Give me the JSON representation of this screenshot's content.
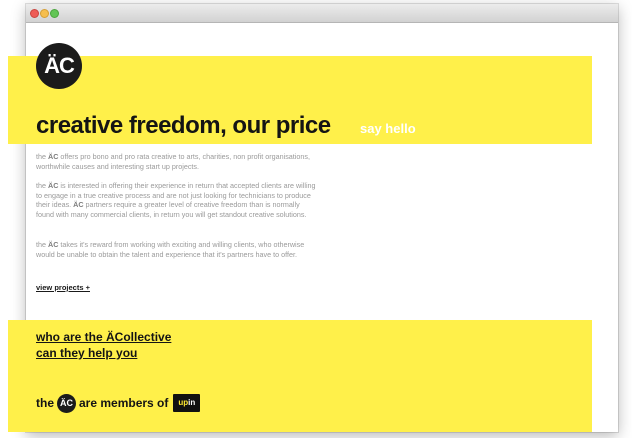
{
  "window": {
    "controls": [
      "close",
      "minimize",
      "zoom"
    ]
  },
  "logo": {
    "text": "ÄC"
  },
  "hero": {
    "headline": "creative freedom, our price",
    "say_hello": "say hello"
  },
  "intro": {
    "p1_prefix": "the ",
    "p1_brand": "ÄC",
    "p1_rest": " offers pro bono and pro rata creative to arts, charities, non profit organisations, worthwhile causes and interesting start up projects.",
    "p2_prefix": "the ",
    "p2_brand": "ÄC",
    "p2_mid": " is interested in offering their experience in return that accepted clients are willing to engage in a true creative process and are not just looking for technicians to produce their ideas. ",
    "p2_brand2": "ÄC",
    "p2_rest": " partners require a greater level of creative freedom than is normally found with many commercial clients, in return you will get standout creative solutions.",
    "p3_prefix": "the ",
    "p3_brand": "ÄC",
    "p3_rest": " takes it's reward from working with exciting and willing clients, who otherwise would be unable to obtain the talent and experience that it's partners have to offer."
  },
  "links": {
    "view_projects": "view projects +"
  },
  "footer": {
    "question1": "who are the ÄCollective",
    "question2": "can they help you",
    "members_prefix": "the",
    "members_logo": "ÄC",
    "members_suffix": "are members of",
    "partner_logo_a": "up",
    "partner_logo_b": "in"
  },
  "colors": {
    "accent_yellow": "#fff04a",
    "dark": "#1b1b1b",
    "body_gray": "#9a9a9a"
  }
}
